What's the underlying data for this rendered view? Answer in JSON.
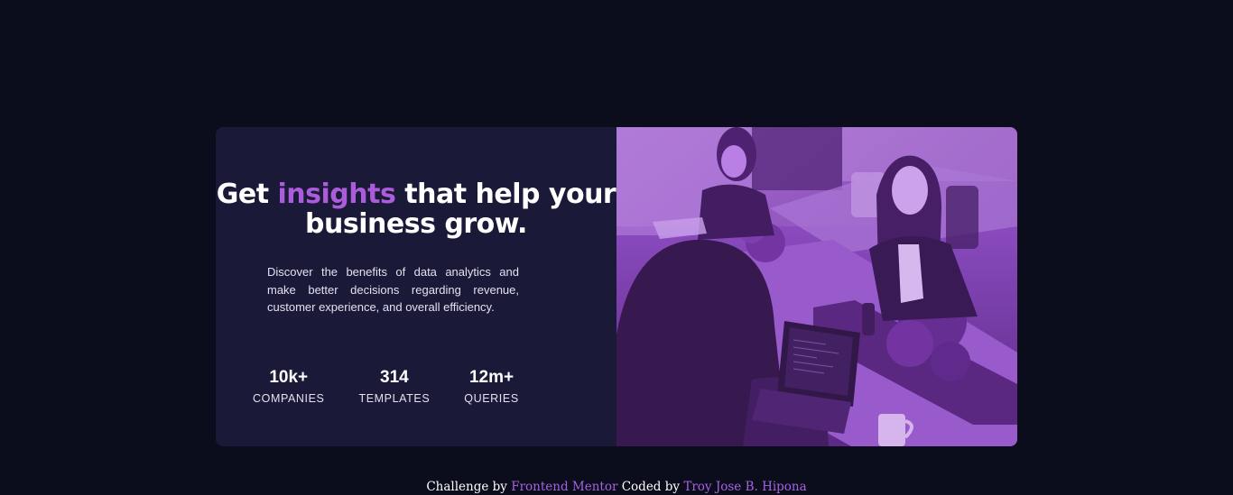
{
  "hero": {
    "headline_before": "Get ",
    "headline_accent": "insights",
    "headline_after": " that help your business grow.",
    "description": "Discover the benefits of data analytics and make better decisions regarding revenue, customer experience, and overall efficiency."
  },
  "stats": [
    {
      "value": "10k+",
      "label": "Companies"
    },
    {
      "value": "314",
      "label": "Templates"
    },
    {
      "value": "12m+",
      "label": "Queries"
    }
  ],
  "image": {
    "icon": "office-team-photo"
  },
  "footer": {
    "challenge_prefix": "Challenge by",
    "challenge_link": "Frontend Mentor",
    "coded_prefix": "Coded by",
    "author_link": "Troy Jose B. Hipona"
  },
  "colors": {
    "page_background": "#0b0d1c",
    "card_background": "#1b1938",
    "accent": "#ab5cdb",
    "image_overlay": "#8d47c3"
  }
}
